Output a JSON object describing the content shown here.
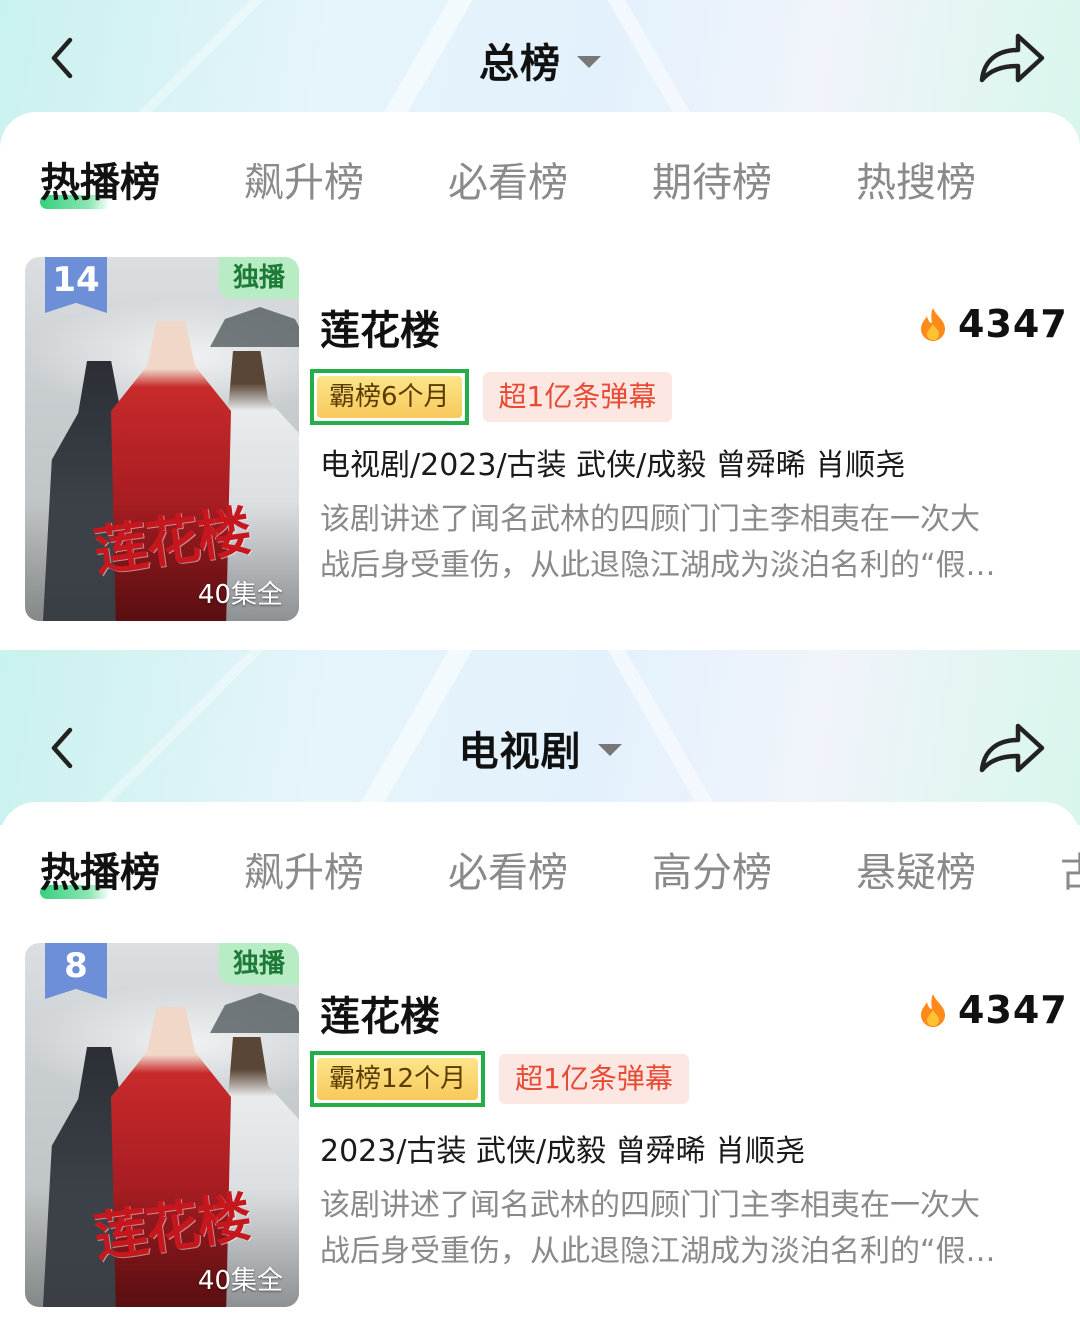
{
  "panels": [
    {
      "header_title": "总榜",
      "tabs": [
        "热播榜",
        "飙升榜",
        "必看榜",
        "期待榜",
        "热搜榜"
      ],
      "item": {
        "rank": "14",
        "exclusive": "独播",
        "episodes": "40集全",
        "poster_logo": "莲花楼",
        "title": "莲花楼",
        "heat": "4347",
        "tag_top": "霸榜6个月",
        "tag_danmu": "超1亿条弹幕",
        "meta": "电视剧/2023/古装 武侠/成毅 曾舜晞 肖顺尧",
        "desc_line1": "该剧讲述了闻名武林的四顾门门主李相夷在一次大",
        "desc_line2": "战后身受重伤，从此退隐江湖成为淡泊名利的“假…"
      }
    },
    {
      "header_title": "电视剧",
      "tabs": [
        "热播榜",
        "飙升榜",
        "必看榜",
        "高分榜",
        "悬疑榜",
        "古"
      ],
      "item": {
        "rank": "8",
        "exclusive": "独播",
        "episodes": "40集全",
        "poster_logo": "莲花楼",
        "title": "莲花楼",
        "heat": "4347",
        "tag_top": "霸榜12个月",
        "tag_danmu": "超1亿条弹幕",
        "meta": "2023/古装 武侠/成毅 曾舜晞 肖顺尧",
        "desc_line1": "该剧讲述了闻名武林的四顾门门主李相夷在一次大",
        "desc_line2": "战后身受重伤，从此退隐江湖成为淡泊名利的“假…"
      }
    }
  ],
  "colors": {
    "highlight_border": "#23ae4a",
    "tab_underline": "#35d07f",
    "danmu_text": "#e84a33",
    "rank_badge": "#6d8fd8",
    "heat_flame": "#ff8a1a"
  }
}
